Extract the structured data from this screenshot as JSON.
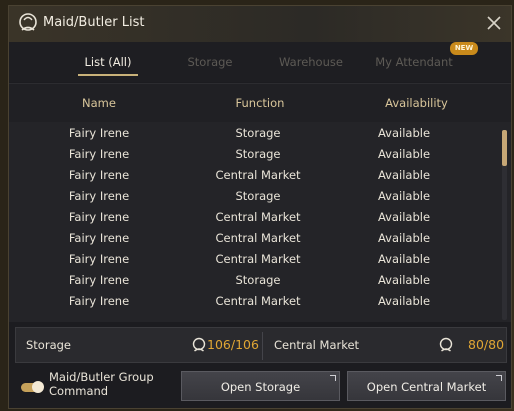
{
  "window": {
    "title": "Maid/Butler List"
  },
  "tabs": [
    {
      "label": "List (All)",
      "active": true
    },
    {
      "label": "Storage",
      "active": false
    },
    {
      "label": "Warehouse",
      "active": false
    },
    {
      "label": "My Attendant",
      "active": false,
      "badge": "NEW"
    }
  ],
  "columns": {
    "name": "Name",
    "function": "Function",
    "availability": "Availability"
  },
  "rows": [
    {
      "name": "Fairy Irene",
      "function": "Storage",
      "availability": "Available"
    },
    {
      "name": "Fairy Irene",
      "function": "Storage",
      "availability": "Available"
    },
    {
      "name": "Fairy Irene",
      "function": "Central Market",
      "availability": "Available"
    },
    {
      "name": "Fairy Irene",
      "function": "Storage",
      "availability": "Available"
    },
    {
      "name": "Fairy Irene",
      "function": "Central Market",
      "availability": "Available"
    },
    {
      "name": "Fairy Irene",
      "function": "Central Market",
      "availability": "Available"
    },
    {
      "name": "Fairy Irene",
      "function": "Central Market",
      "availability": "Available"
    },
    {
      "name": "Fairy Irene",
      "function": "Storage",
      "availability": "Available"
    },
    {
      "name": "Fairy Irene",
      "function": "Central Market",
      "availability": "Available"
    }
  ],
  "storage_bar": {
    "storage_label": "Storage",
    "storage_value": "106/106",
    "market_label": "Central Market",
    "market_value": "80/80"
  },
  "footer": {
    "group_command_label": "Maid/Butler Group Command",
    "group_command_enabled": true,
    "open_storage_label": "Open Storage",
    "open_market_label": "Open Central Market"
  },
  "colors": {
    "accent_gold": "#c9b27a",
    "value_orange": "#e0a634",
    "badge_orange": "#c98a1b"
  }
}
